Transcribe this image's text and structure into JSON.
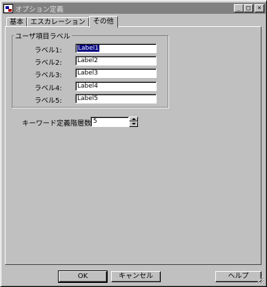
{
  "window": {
    "title": "オプション定義",
    "icon": "app-icon"
  },
  "caption_buttons": {
    "minimize": "_",
    "maximize": "□",
    "close": "×"
  },
  "tabs": [
    {
      "label": "基本",
      "active": false
    },
    {
      "label": "エスカレーション",
      "active": false
    },
    {
      "label": "その他",
      "active": true
    }
  ],
  "user_labels": {
    "group_title": "ユーザ項目ラベル",
    "rows": [
      {
        "label": "ラベル1:",
        "value": "Label1"
      },
      {
        "label": "ラベル2:",
        "value": "Label2"
      },
      {
        "label": "ラベル3:",
        "value": "Label3"
      },
      {
        "label": "ラベル4:",
        "value": "Label4"
      },
      {
        "label": "ラベル5:",
        "value": "Label5"
      }
    ]
  },
  "keyword_levels": {
    "label": "キーワード定義階層数:",
    "value": "5"
  },
  "buttons": {
    "ok": "OK",
    "cancel": "キャンセル",
    "help": "ヘルプ"
  },
  "colors": {
    "title_bar": "#808080",
    "face": "#c0c0c0",
    "selection": "#000080"
  }
}
